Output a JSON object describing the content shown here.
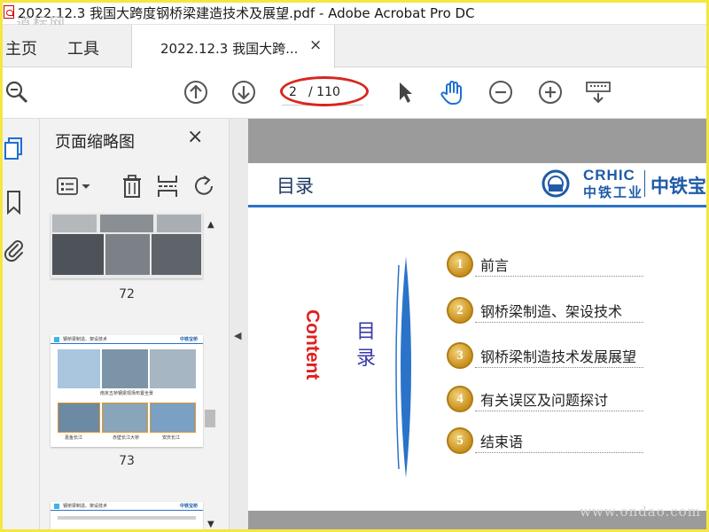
{
  "window": {
    "title": "2022.12.3 我国大跨度钢桥梁建造技术及展望.pdf - Adobe Acrobat Pro DC",
    "watermark": "道标网"
  },
  "tabs": {
    "home": "主页",
    "tools": "工具",
    "document": "2022.12.3 我国大跨...",
    "close": "×"
  },
  "toolbar": {
    "page_current": "2",
    "page_total": "/ 110"
  },
  "panel": {
    "title": "页面缩略图",
    "close": "×",
    "thumbnails": [
      {
        "page": "72"
      },
      {
        "page": "73",
        "heading": "钢桥梁制造、架设技术",
        "logo": "中铁宝桥",
        "caption": "南京五桥钢梁现场布置全景",
        "sub_captions": [
          "嘉鱼长江",
          "赤壁长江大桥",
          "安庆长江"
        ]
      },
      {
        "heading": "钢桥梁制造、架设技术",
        "logo": "中铁宝桥"
      }
    ]
  },
  "slide": {
    "header_title": "目录",
    "logo_en": "CRHIC",
    "logo_cn": "中铁工业",
    "logo_big": "中铁宝",
    "vertical_en": "Content",
    "vertical_cn": [
      "目",
      "录"
    ],
    "toc": [
      {
        "num": "1",
        "label": "前言"
      },
      {
        "num": "2",
        "label": "钢桥梁制造、架设技术"
      },
      {
        "num": "3",
        "label": "钢桥梁制造技术发展展望"
      },
      {
        "num": "4",
        "label": "有关误区及问题探讨"
      },
      {
        "num": "5",
        "label": "结束语"
      }
    ]
  },
  "footer_watermark": "www.ondao.com",
  "colors": {
    "accent": "#2a73c9",
    "highlight_oval": "#d7261e",
    "frame": "#f5e642"
  }
}
